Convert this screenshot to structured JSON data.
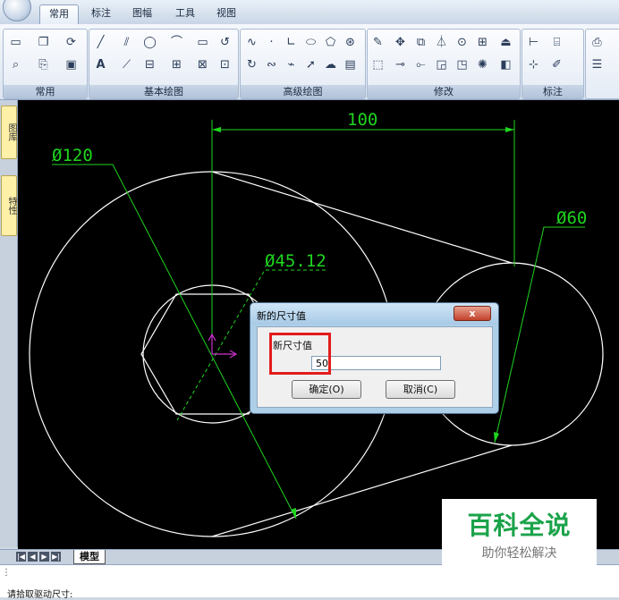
{
  "ribbon": {
    "tabs": [
      {
        "label": "常用",
        "active": true
      },
      {
        "label": "标注",
        "active": false
      },
      {
        "label": "图幅",
        "active": false
      },
      {
        "label": "工具",
        "active": false
      },
      {
        "label": "视图",
        "active": false
      }
    ],
    "panels": [
      {
        "title": "常用"
      },
      {
        "title": "基本绘图"
      },
      {
        "title": "高级绘图"
      },
      {
        "title": "修改"
      },
      {
        "title": "标注"
      }
    ],
    "panel_tools": {
      "common": [
        "new-file-icon",
        "copy-icon",
        "refresh-icon",
        "zoom-icon",
        "paste-icon",
        "save-icon"
      ],
      "basic_draw": [
        "line-icon",
        "parallel-line-icon",
        "circle-icon",
        "arc-icon",
        "rectangle-icon",
        "undo-arc-icon",
        "text-icon",
        "polyline-icon",
        "block-icon",
        "insert-icon",
        "hatch-icon",
        "image-icon"
      ],
      "advanced_draw": [
        "spline-icon",
        "point-icon",
        "angle-icon",
        "ellipse-icon",
        "polygon-icon",
        "hatch-pattern-icon",
        "rotate-draw-icon",
        "wave-icon",
        "broken-line-icon",
        "arrow-icon",
        "cloud-icon",
        "table-icon"
      ],
      "modify": [
        "erase-icon",
        "move-icon",
        "copy-object-icon",
        "mirror-icon",
        "rotate-icon",
        "array-icon",
        "stretch-icon",
        "select-box-icon",
        "trim-icon",
        "extend-icon",
        "fillet-icon",
        "chamfer-icon",
        "explode-icon",
        "offset-icon"
      ],
      "annotate": [
        "linear-dim-icon",
        "dim-style-icon",
        "tolerance-icon",
        "edit-dim-icon",
        "layer-line-icon"
      ]
    }
  },
  "sidebar": {
    "tabs": [
      {
        "label": "图库"
      },
      {
        "label": "特性"
      }
    ]
  },
  "drawing": {
    "dim_top": "100",
    "dim_left_diameter": "Ø120",
    "dim_right_diameter": "Ø60",
    "dim_inner_diameter": "Ø45.12",
    "colors": {
      "background": "#000000",
      "geometry": "#ffffff",
      "dimension": "#1fd51f",
      "origin_marker": "#cc33cc"
    }
  },
  "dialog": {
    "title": "新的尺寸值",
    "close_label": "x",
    "field_label": "新尺寸值",
    "field_value": "50",
    "ok_label": "确定(O)",
    "cancel_label": "取消(C)"
  },
  "layout_tabs": {
    "nav": [
      "|◀",
      "◀",
      "▶",
      "▶|"
    ],
    "model_tab": "模型"
  },
  "command_line": {
    "grip": "⋮",
    "prompt": "请拾取驱动尺寸:"
  },
  "watermark": {
    "title": "百科全说",
    "subtitle": "助你轻松解决"
  }
}
